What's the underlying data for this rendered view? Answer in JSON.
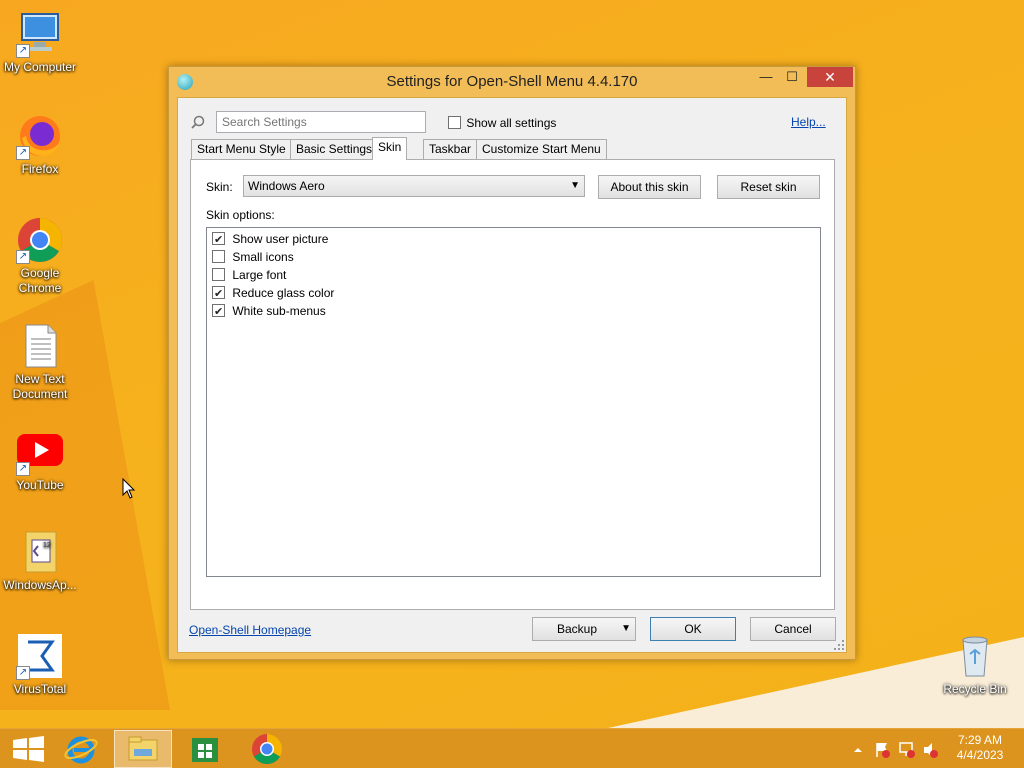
{
  "desktop": {
    "icons": [
      {
        "label": "My Computer"
      },
      {
        "label": "Firefox"
      },
      {
        "label": "Google Chrome"
      },
      {
        "label": "New Text Document"
      },
      {
        "label": "YouTube"
      },
      {
        "label": "WindowsAp..."
      },
      {
        "label": "VirusTotal"
      },
      {
        "label": "Recycle Bin"
      }
    ]
  },
  "window": {
    "title": "Settings for Open-Shell Menu 4.4.170",
    "controls": {
      "minimize": "—",
      "maximize": "☐",
      "close": "✕"
    }
  },
  "search": {
    "placeholder": "Search Settings",
    "value": ""
  },
  "show_all": {
    "label": "Show all settings",
    "checked": false
  },
  "help_link": "Help...",
  "tabs": [
    {
      "label": "Start Menu Style"
    },
    {
      "label": "Basic Settings"
    },
    {
      "label": "Skin",
      "active": true
    },
    {
      "label": "Taskbar"
    },
    {
      "label": "Customize Start Menu"
    }
  ],
  "skin": {
    "label": "Skin:",
    "selected": "Windows Aero",
    "about_button": "About this skin",
    "reset_button": "Reset skin"
  },
  "skin_options": {
    "label": "Skin options:",
    "items": [
      {
        "label": "Show user picture",
        "checked": true
      },
      {
        "label": "Small icons",
        "checked": false
      },
      {
        "label": "Large font",
        "checked": false
      },
      {
        "label": "Reduce glass color",
        "checked": true
      },
      {
        "label": "White sub-menus",
        "checked": true
      }
    ]
  },
  "footer": {
    "homepage_link": "Open-Shell Homepage",
    "backup_button": "Backup",
    "ok_button": "OK",
    "cancel_button": "Cancel"
  },
  "taskbar": {
    "clock_time": "7:29 AM",
    "clock_date": "4/4/2023"
  },
  "colors": {
    "accent": "#3c7fb1",
    "close": "#c7433b",
    "link": "#0645ad"
  }
}
